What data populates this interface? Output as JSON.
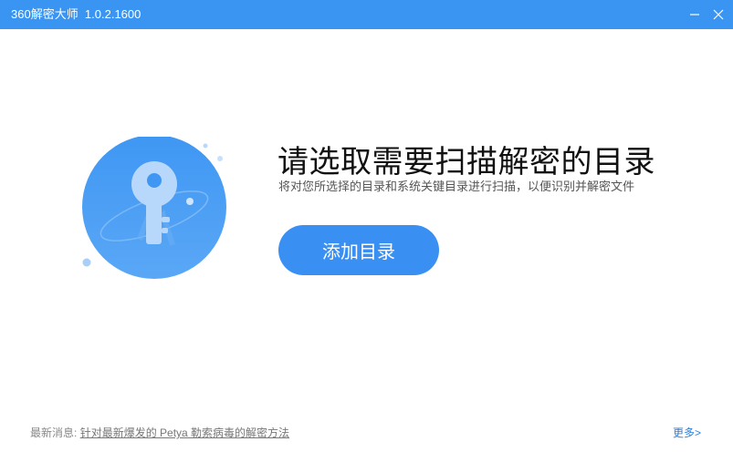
{
  "window": {
    "title": "360解密大师  1.0.2.1600",
    "minimize_icon": "minimize-icon",
    "close_icon": "close-icon",
    "accent_color": "#3a95f2"
  },
  "main": {
    "heading": "请选取需要扫描解密的目录",
    "subheading": "将对您所选择的目录和系统关键目录进行扫描，以便识别并解密文件",
    "add_button_label": "添加目录",
    "button_color": "#3a8ff2",
    "illustration_icon": "key-icon"
  },
  "footer": {
    "news_prefix": "最新消息:",
    "news_link": "针对最新爆发的 Petya 勒索病毒的解密方法",
    "more_link": "更多>"
  }
}
